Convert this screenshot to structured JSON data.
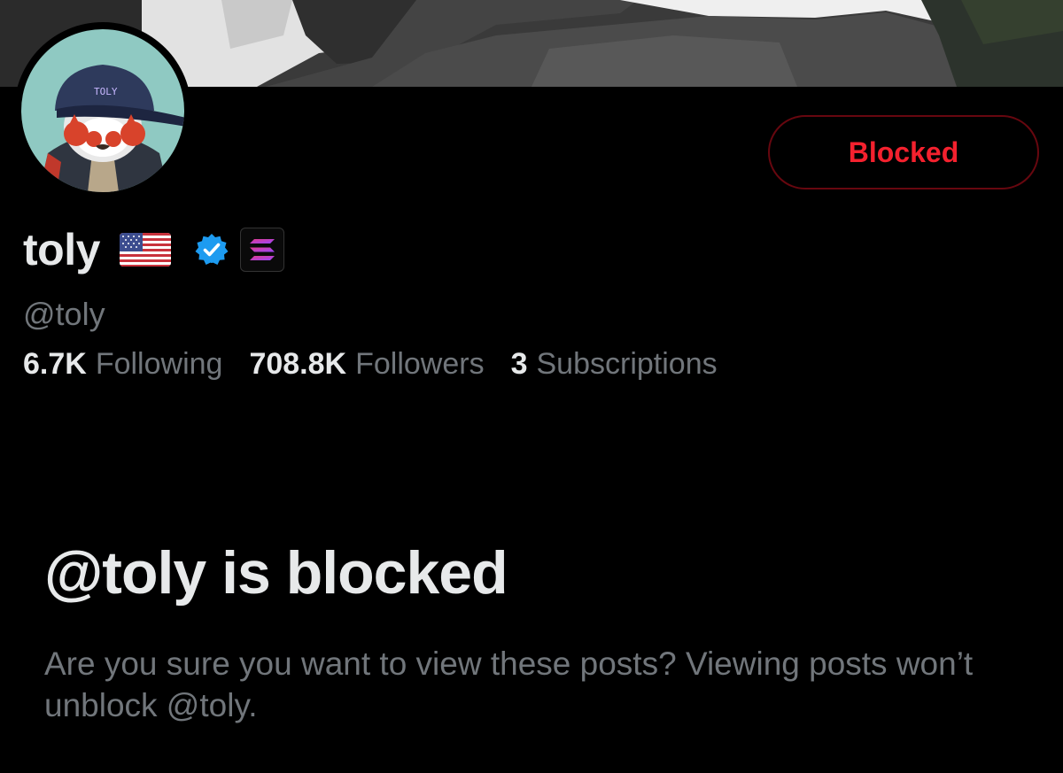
{
  "profile": {
    "display_name": "toly",
    "handle": "@toly",
    "cap_text": "TOLY"
  },
  "badges": {
    "flag": "us-flag-icon",
    "verified": "verified-badge-icon",
    "affiliate": "solana-logo-icon"
  },
  "actions": {
    "blocked_label": "Blocked"
  },
  "stats": [
    {
      "value": "6.7K",
      "label": "Following"
    },
    {
      "value": "708.8K",
      "label": "Followers"
    },
    {
      "value": "3",
      "label": "Subscriptions"
    }
  ],
  "notice": {
    "title": "@toly is blocked",
    "body": "Are you sure you want to view these posts? Viewing posts won’t unblock @toly."
  },
  "colors": {
    "background": "#000000",
    "primary_text": "#e7e9ea",
    "secondary_text": "#71767b",
    "blocked_red": "#f4212e",
    "blocked_border": "#67070f",
    "verified_blue": "#1d9bf0"
  }
}
